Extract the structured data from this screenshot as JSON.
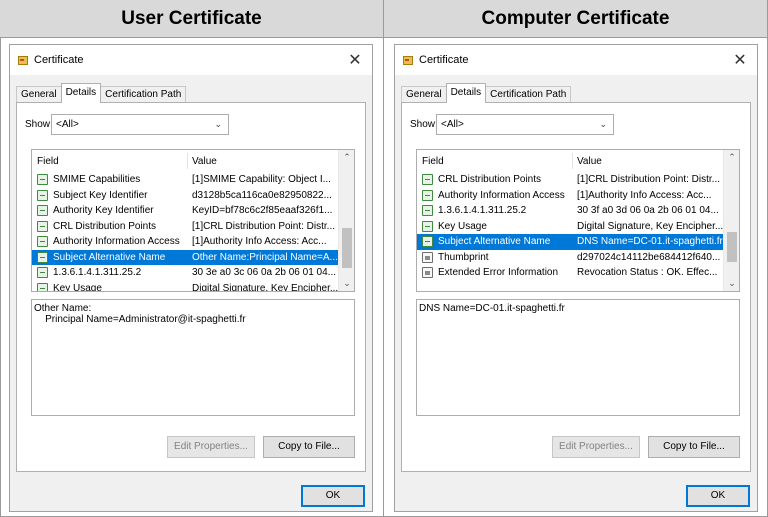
{
  "headers": {
    "left": "User Certificate",
    "right": "Computer Certificate"
  },
  "dialogs": [
    {
      "title": "Certificate",
      "close_label": "✕",
      "tabs": [
        "General",
        "Details",
        "Certification Path"
      ],
      "active_tab": "Details",
      "show_label": "Show:",
      "show_value": "<All>",
      "columns": {
        "field": "Field",
        "value": "Value"
      },
      "rows": [
        {
          "field": "SMIME Capabilities",
          "value": "[1]SMIME Capability: Object I...",
          "icon": "cert-extension-icon"
        },
        {
          "field": "Subject Key Identifier",
          "value": "d3128b5ca116ca0e82950822...",
          "icon": "cert-extension-icon"
        },
        {
          "field": "Authority Key Identifier",
          "value": "KeyID=bf78c6c2f85eaaf326f1...",
          "icon": "cert-extension-icon"
        },
        {
          "field": "CRL Distribution Points",
          "value": "[1]CRL Distribution Point: Distr...",
          "icon": "cert-extension-icon"
        },
        {
          "field": "Authority Information Access",
          "value": "[1]Authority Info Access: Acc...",
          "icon": "cert-extension-icon"
        },
        {
          "field": "Subject Alternative Name",
          "value": "Other Name:Principal Name=A...",
          "icon": "cert-extension-icon",
          "selected": true
        },
        {
          "field": "1.3.6.1.4.1.311.25.2",
          "value": "30 3e a0 3c 06 0a 2b 06 01 04...",
          "icon": "cert-extension-icon"
        },
        {
          "field": "Key Usage",
          "value": "Digital Signature, Key Encipher...",
          "icon": "cert-extension-icon"
        }
      ],
      "detail_text": "Other Name:\n    Principal Name=Administrator@it-spaghetti.fr",
      "edit_properties_label": "Edit Properties...",
      "copy_to_file_label": "Copy to File...",
      "ok_label": "OK"
    },
    {
      "title": "Certificate",
      "close_label": "✕",
      "tabs": [
        "General",
        "Details",
        "Certification Path"
      ],
      "active_tab": "Details",
      "show_label": "Show:",
      "show_value": "<All>",
      "columns": {
        "field": "Field",
        "value": "Value"
      },
      "rows": [
        {
          "field": "CRL Distribution Points",
          "value": "[1]CRL Distribution Point: Distr...",
          "icon": "cert-extension-icon"
        },
        {
          "field": "Authority Information Access",
          "value": "[1]Authority Info Access: Acc...",
          "icon": "cert-extension-icon"
        },
        {
          "field": "1.3.6.1.4.1.311.25.2",
          "value": "30 3f a0 3d 06 0a 2b 06 01 04...",
          "icon": "cert-extension-icon"
        },
        {
          "field": "Key Usage",
          "value": "Digital Signature, Key Encipher...",
          "icon": "cert-extension-icon"
        },
        {
          "field": "Subject Alternative Name",
          "value": "DNS Name=DC-01.it-spaghetti.fr",
          "icon": "cert-extension-icon",
          "selected": true
        },
        {
          "field": "Thumbprint",
          "value": "d297024c14112be684412f640...",
          "icon": "cert-property-icon"
        },
        {
          "field": "Extended Error Information",
          "value": "Revocation Status : OK. Effec...",
          "icon": "cert-property-icon"
        }
      ],
      "detail_text": "DNS Name=DC-01.it-spaghetti.fr",
      "edit_properties_label": "Edit Properties...",
      "copy_to_file_label": "Copy to File...",
      "ok_label": "OK"
    }
  ],
  "colors": {
    "selection": "#0078d7",
    "header_bg": "#d9d9d9",
    "dialog_bg": "#f0f0f0"
  }
}
